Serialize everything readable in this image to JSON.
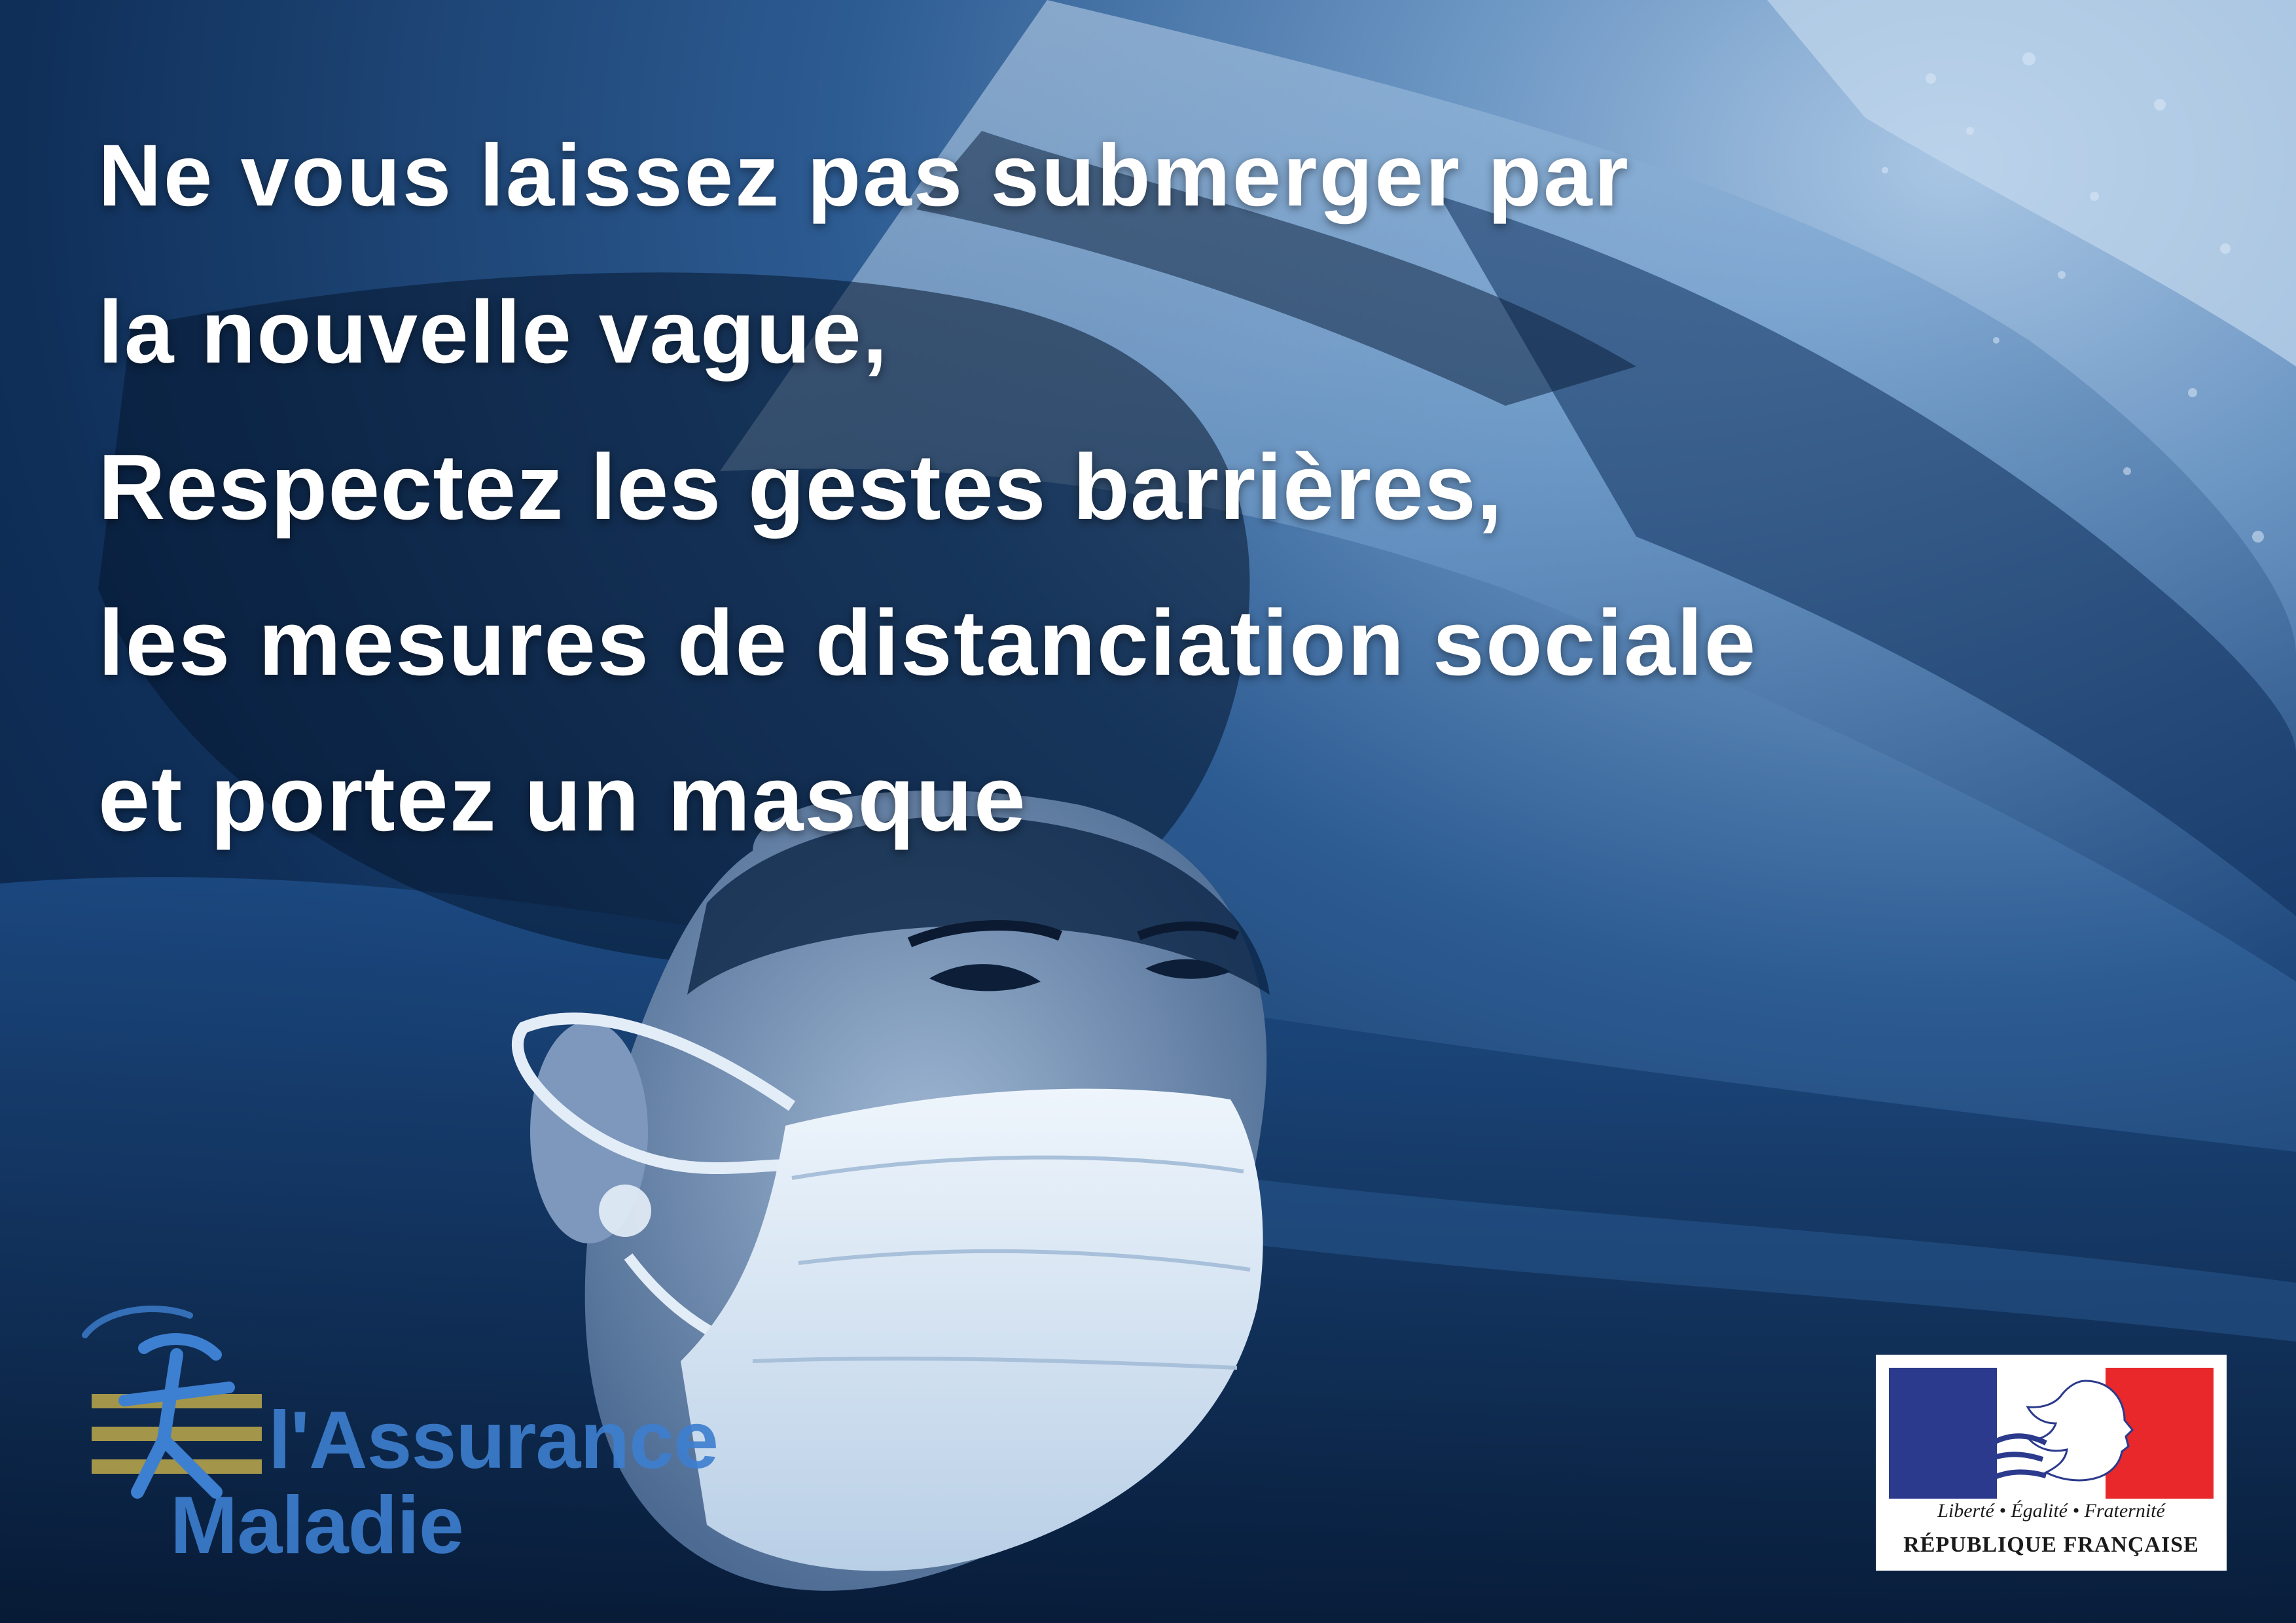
{
  "headline": {
    "line1": "Ne vous laissez pas submerger par",
    "line2": "la nouvelle vague,",
    "line3": "Respectez les gestes barrières,",
    "line4": "les mesures de distanciation sociale",
    "line5": "et portez un masque"
  },
  "assurance_maladie_logo": {
    "line1": "l'Assurance",
    "line2": "Maladie"
  },
  "republique_logo": {
    "motto": "Liberté • Égalité • Fraternité",
    "name": "RÉPUBLIQUE FRANÇAISE"
  },
  "colors": {
    "text": "#ffffff",
    "assurance_blue": "#3d7fd0",
    "flag_blue": "#2b3a8c",
    "flag_red": "#e8282a"
  }
}
